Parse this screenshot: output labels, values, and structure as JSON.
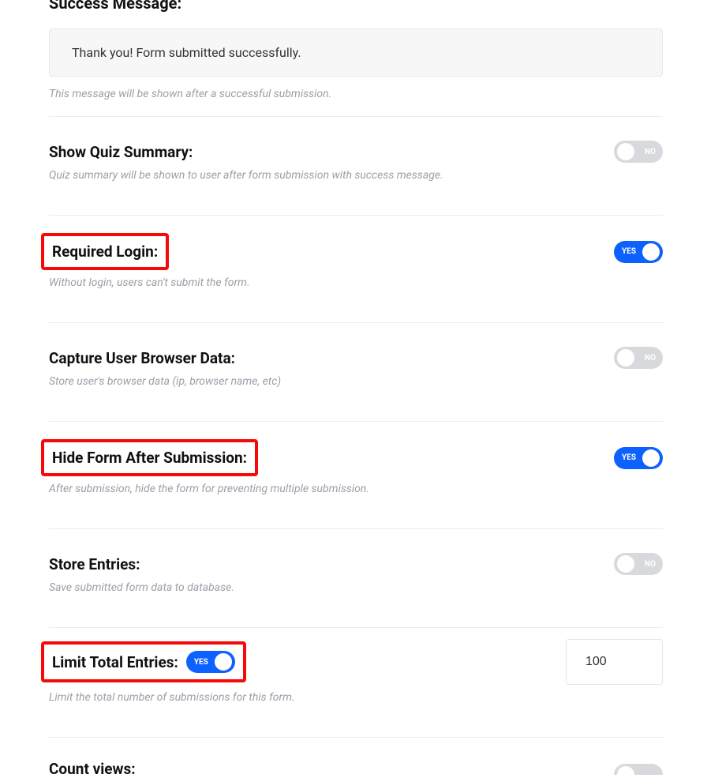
{
  "successMessage": {
    "title": "Success Message:",
    "value": "Thank you! Form submitted successfully.",
    "help": "This message will be shown after a successful submission."
  },
  "settings": {
    "quizSummary": {
      "label": "Show Quiz Summary:",
      "help": "Quiz summary will be shown to user after form submission with success message.",
      "state": "NO"
    },
    "requiredLogin": {
      "label": "Required Login:",
      "help": "Without login, users can't submit the form.",
      "state": "YES"
    },
    "captureBrowser": {
      "label": "Capture User Browser Data:",
      "help": "Store user's browser data (ip, browser name, etc)",
      "state": "NO"
    },
    "hideForm": {
      "label": "Hide Form After Submission:",
      "help": "After submission, hide the form for preventing multiple submission.",
      "state": "YES"
    },
    "storeEntries": {
      "label": "Store Entries:",
      "help": "Save submitted form data to database.",
      "state": "NO"
    },
    "limitEntries": {
      "label": "Limit Total Entries:",
      "help": "Limit the total number of submissions for this form.",
      "state": "YES",
      "value": "100"
    },
    "countViews": {
      "label": "Count views:"
    }
  }
}
